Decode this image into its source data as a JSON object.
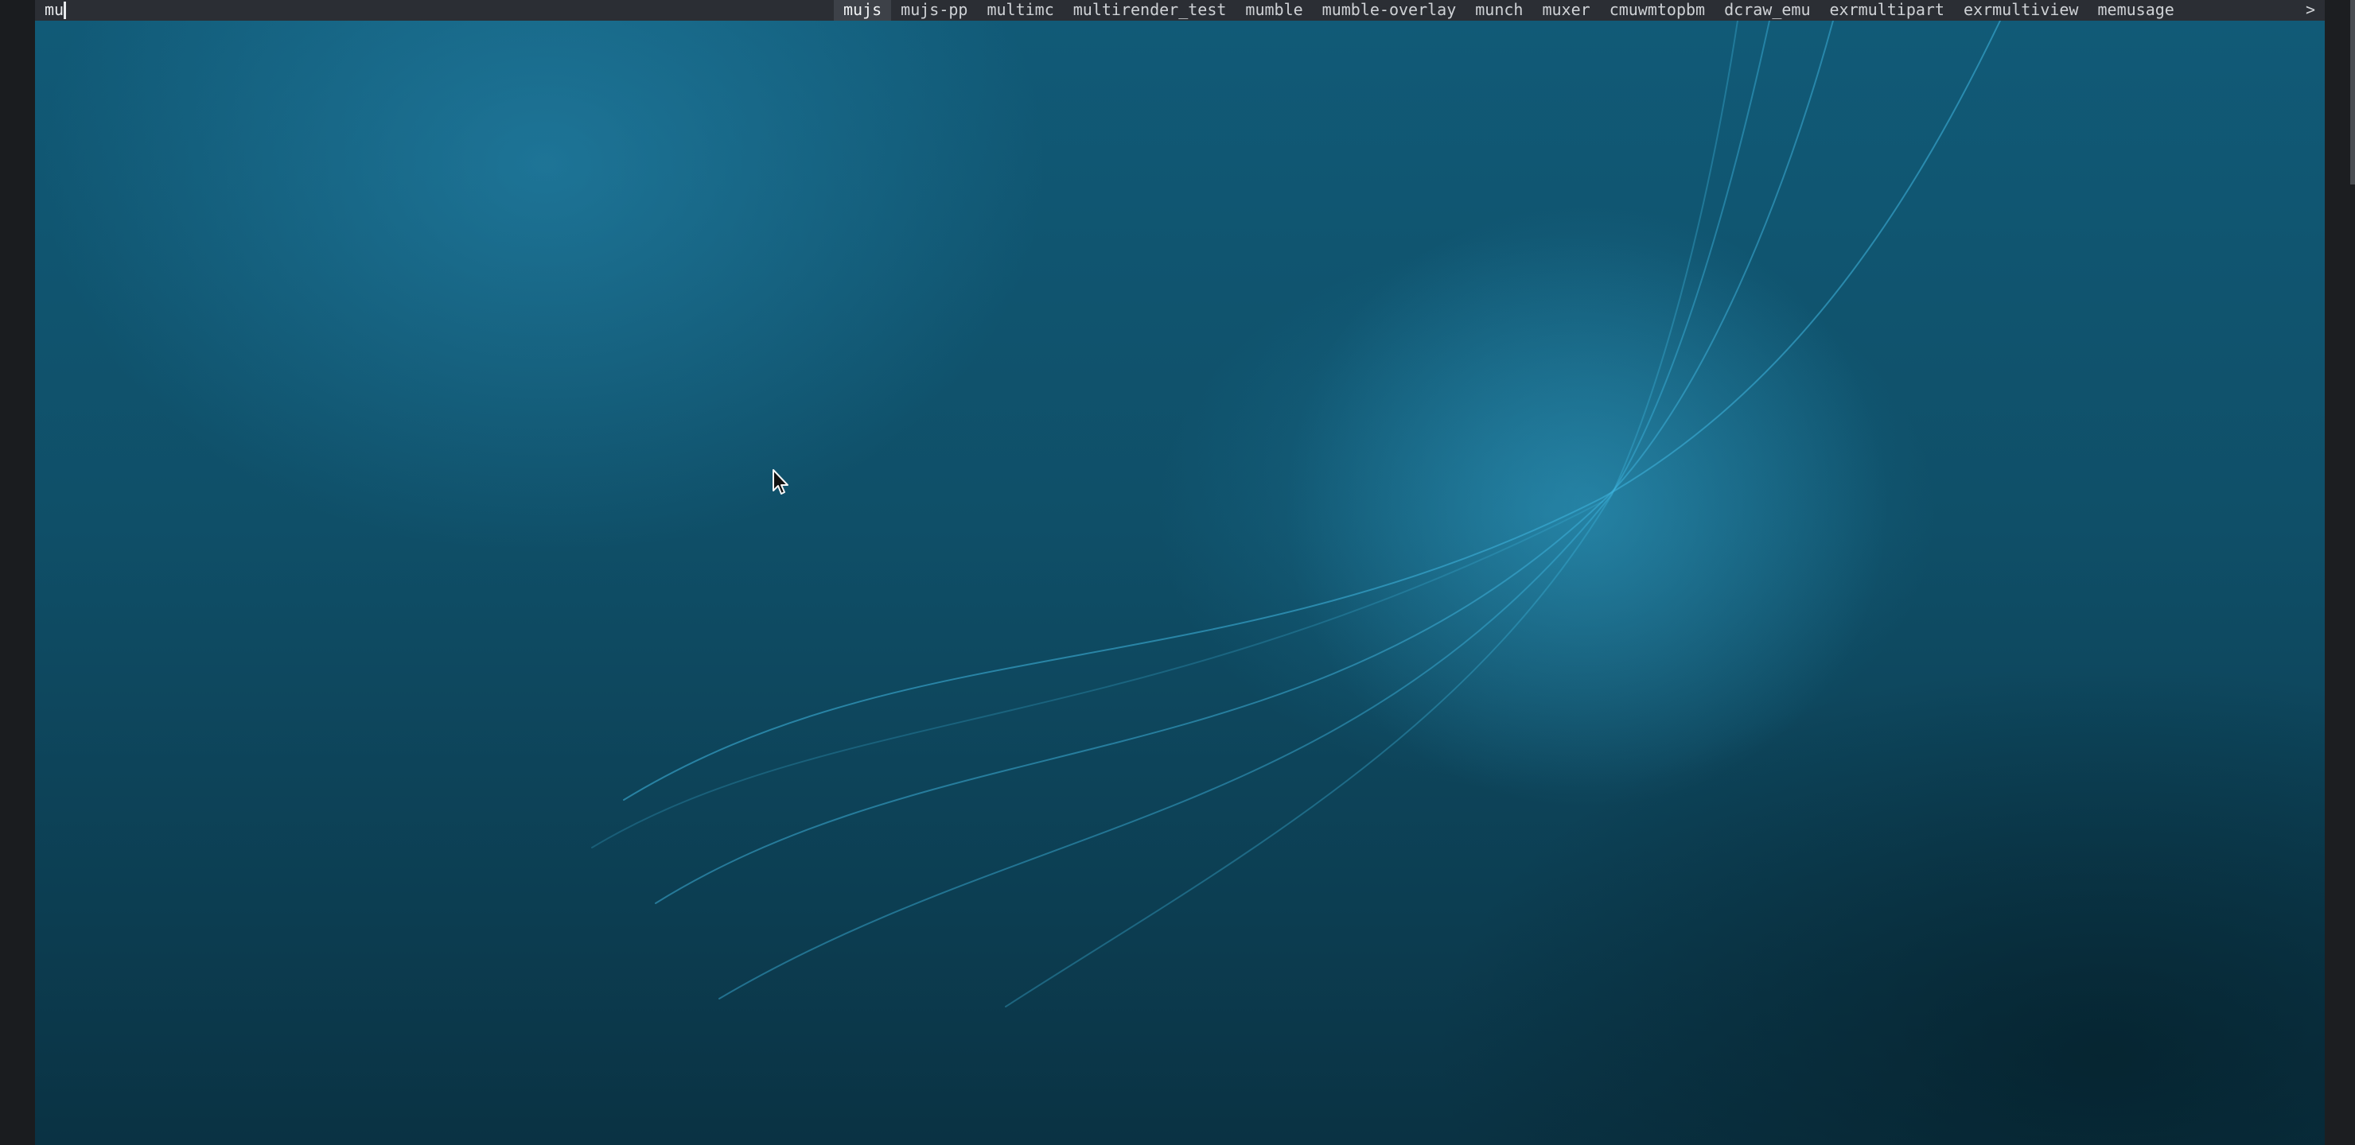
{
  "dmenu": {
    "input_text": "mu",
    "items": [
      "mujs",
      "mujs-pp",
      "multimc",
      "multirender_test",
      "mumble",
      "mumble-overlay",
      "munch",
      "muxer",
      "cmuwmtopbm",
      "dcraw_emu",
      "exrmultipart",
      "exrmultiview",
      "memusage"
    ],
    "selected_item": "mujs",
    "more_indicator": ">"
  },
  "icons": {
    "pointer": "mouse-pointer-icon"
  },
  "colors": {
    "bar_background": "#2b2e34",
    "selected_background": "#3d4148",
    "wallpaper_primary": "#115a77",
    "wallpaper_dark": "#0a3243",
    "curve_highlight": "#3fb6e0"
  }
}
